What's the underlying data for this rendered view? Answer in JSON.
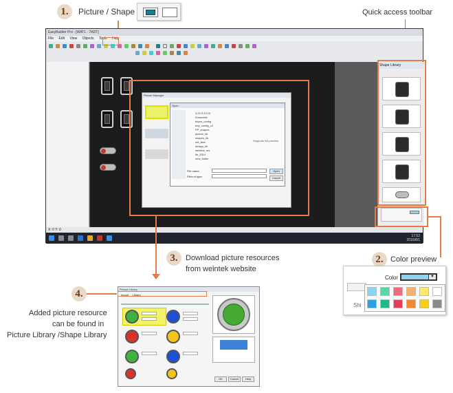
{
  "callouts": {
    "c1": {
      "num": "1.",
      "label": "Picture / Shape"
    },
    "c2": {
      "num": "2.",
      "label": "Color preview"
    },
    "c3": {
      "num": "3.",
      "line1": "Download picture resources",
      "line2": "from weintek website"
    },
    "c4": {
      "num": "4.",
      "line1": "Added picture resource",
      "line2": "can be found in",
      "line3": "Picture Library /Shape Library"
    },
    "quick_access": "Quick access toolbar"
  },
  "screen": {
    "title": "EasyBuilder Pro - [WAT1 - 7ADT]",
    "menu": [
      "File",
      "Edit",
      "View",
      "Objects",
      "Tools",
      "Help"
    ],
    "status_left": "X: 0 Y: 0",
    "clock": "17:52",
    "date": "2016/8/1",
    "right_panel_title": "Shape Library"
  },
  "inner_dialog": {
    "title": "Picture Manager",
    "file_dialog_title": "Open",
    "file_rows": [
      "3.22.0.23.15",
      "Ensemble",
      "ebpro_config",
      "ebp_config_v2",
      "PP_shapes",
      "picture_lib",
      "shapes_lib",
      "old_files",
      "design_lib",
      "weintek_res",
      "lib_2014",
      "new_folder"
    ],
    "open_btn": "Open",
    "cancel_btn": "Cancel",
    "filename_label": "File name:",
    "filetype_label": "Files of type:",
    "preview_text": "Supports full preview"
  },
  "color_popup": {
    "label": "Color",
    "partial_left": "Shi",
    "swatches": [
      "#8fd3f4",
      "#5bd6a5",
      "#f36b7f",
      "#f6b26b",
      "#ffe96b",
      "#ffffff",
      "#29a3e0",
      "#1fb98a",
      "#e53c5a",
      "#f08a2c",
      "#f2cf1c",
      "#8a8a8a"
    ]
  },
  "library_dialog": {
    "title": "Picture Library",
    "tabs": [
      "Import",
      "Library"
    ],
    "colors": [
      "#3fb33f",
      "#1e4fd8",
      "#d8342b",
      "#f0c419",
      "#3fb33f",
      "#1e4fd8"
    ],
    "preview_color": "#44aa33",
    "ok": "OK",
    "cancel": "Cancel",
    "help": "Help"
  }
}
